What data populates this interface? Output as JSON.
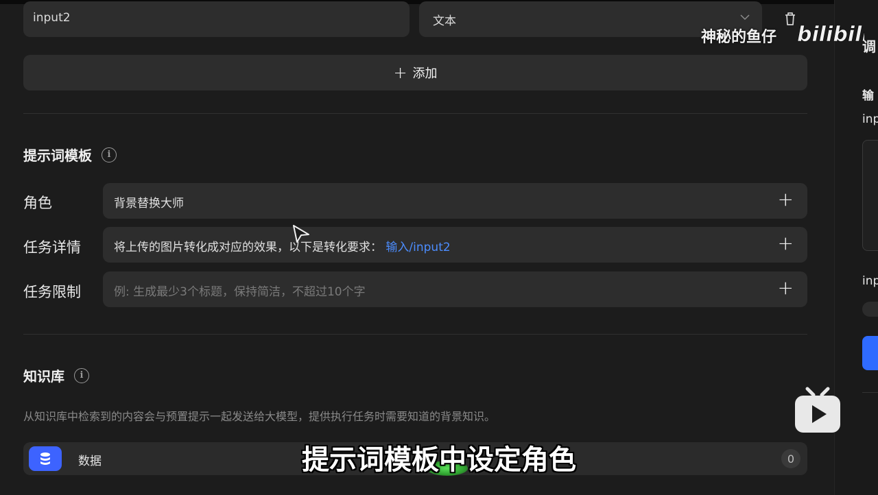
{
  "params": {
    "name_value": "input2",
    "type_value": "文本",
    "add_label": "添加"
  },
  "prompt_template": {
    "title": "提示词模板",
    "rows": [
      {
        "label": "角色",
        "value": "背景替换大师",
        "link": ""
      },
      {
        "label": "任务详情",
        "value": "将上传的图片转化成对应的效果，以下是转化要求：",
        "link": "输入/input2"
      },
      {
        "label": "任务限制",
        "placeholder": "例: 生成最少3个标题，保持简洁，不超过10个字"
      }
    ]
  },
  "knowledge": {
    "title": "知识库",
    "description": "从知识库中检索到的内容会与预置提示一起发送给大模型，提供执行任务时需要知道的背景知识。",
    "item_label": "数据",
    "item_count": "0"
  },
  "right_panel": {
    "title_partial": "调",
    "section_partial": "输",
    "field1_partial": "inp",
    "field2_partial": "inp"
  },
  "overlay": {
    "subtitle": "提示词模板中设定角色",
    "watermark": "神秘的鱼仔",
    "logo_text": "bilibili"
  },
  "colors": {
    "accent_link": "#4c8dff",
    "db_icon_bg": "#3d63ff",
    "panel_bg": "#1c1c1c",
    "field_bg": "#2d2d2d"
  }
}
